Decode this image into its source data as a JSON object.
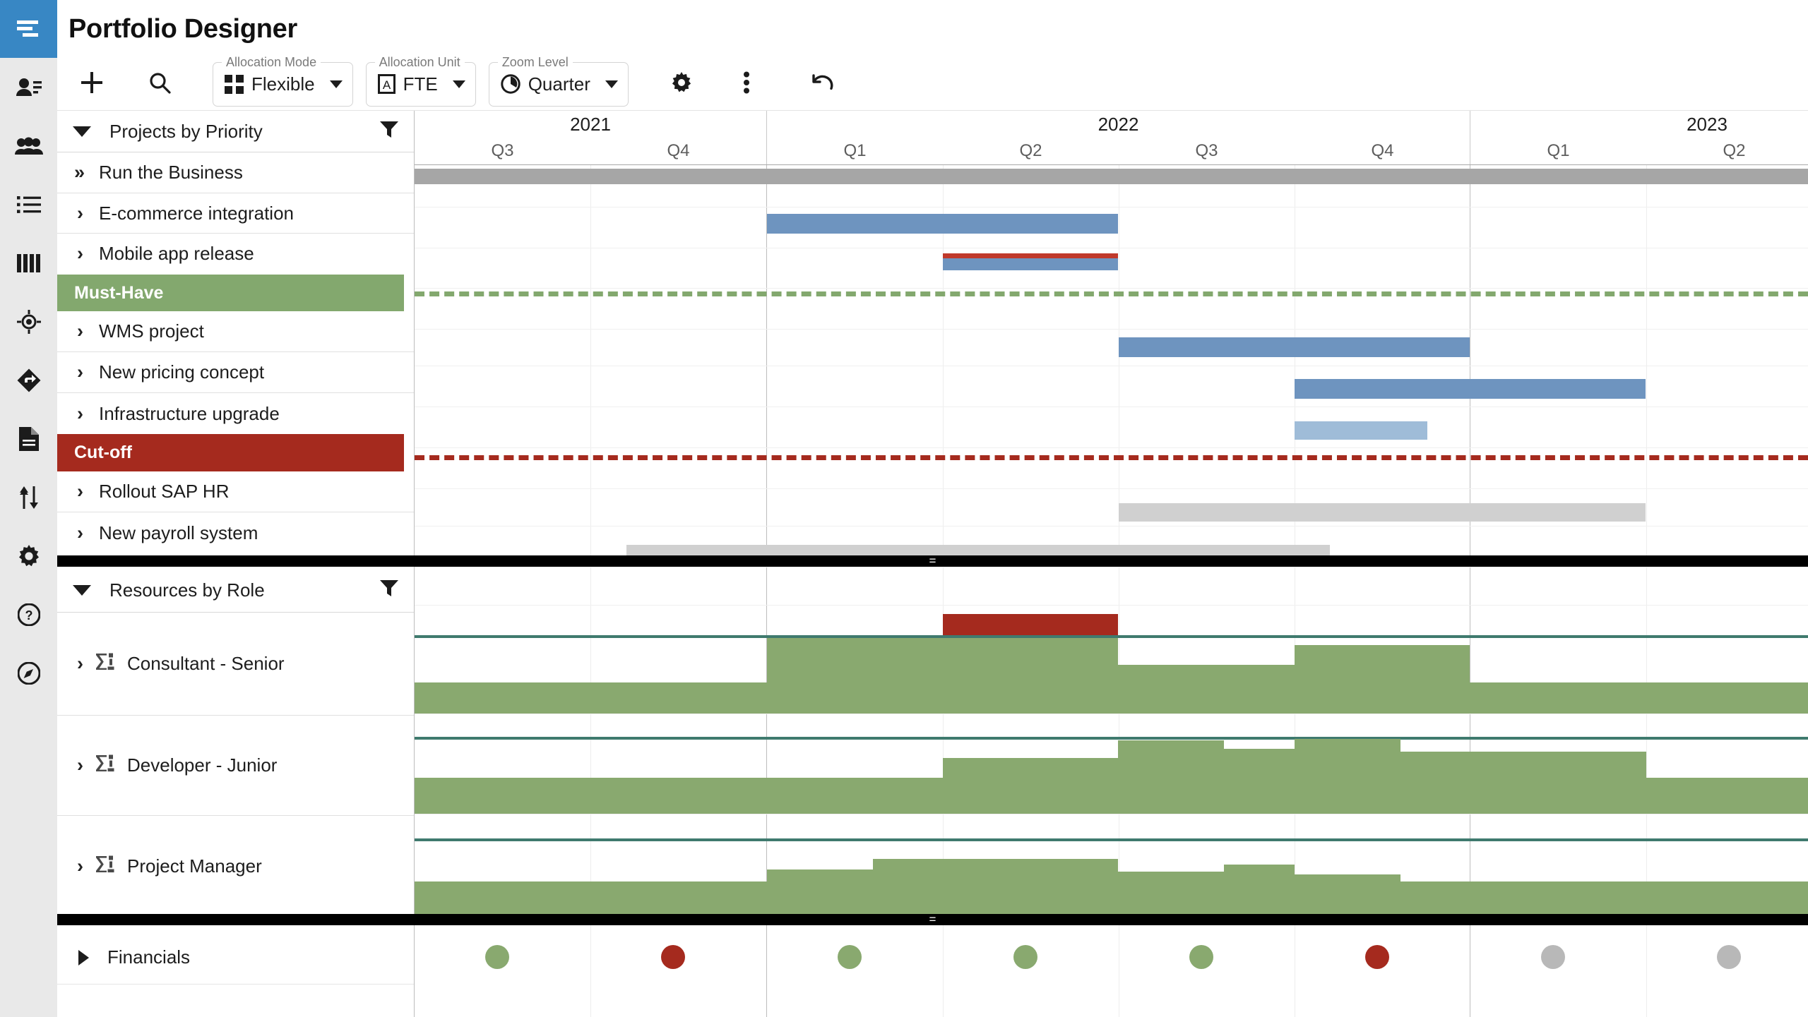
{
  "app": {
    "title": "Portfolio Designer",
    "accent_blue": "#3887c4",
    "rail_bg": "#e9e9e9"
  },
  "rail": {
    "items": [
      {
        "icon": "hamburger-menu-icon",
        "active": true
      },
      {
        "icon": "person-details-icon",
        "active": false
      },
      {
        "icon": "people-group-icon",
        "active": false
      },
      {
        "icon": "list-bullets-icon",
        "active": false
      },
      {
        "icon": "bar-columns-icon",
        "active": false
      },
      {
        "icon": "target-crosshair-icon",
        "active": false
      },
      {
        "icon": "route-directions-icon",
        "active": false
      },
      {
        "icon": "document-icon",
        "active": false
      },
      {
        "icon": "sort-arrows-icon",
        "active": false
      },
      {
        "icon": "gear-settings-icon",
        "active": false
      },
      {
        "icon": "help-question-icon",
        "active": false
      },
      {
        "icon": "compass-explore-icon",
        "active": false
      }
    ]
  },
  "toolbar": {
    "add_label": "+",
    "add_name": "add-icon",
    "search_name": "search-icon",
    "allocation_mode": {
      "legend": "Allocation Mode",
      "value": "Flexible",
      "icon": "grid-squares-icon"
    },
    "allocation_unit": {
      "legend": "Allocation Unit",
      "value": "FTE",
      "icon": "letter-a-boxed-icon"
    },
    "zoom_level": {
      "legend": "Zoom Level",
      "value": "Quarter",
      "icon": "clock-pie-icon"
    },
    "settings_name": "gear-icon",
    "more_name": "more-vertical-icon",
    "undo_name": "undo-arrow-icon"
  },
  "projects_panel": {
    "header": "Projects by Priority",
    "filter_icon": "filter-funnel-icon",
    "rows": [
      {
        "label": "Run the Business",
        "chevron": "double-chevron-right",
        "type": "project"
      },
      {
        "label": "E-commerce integration",
        "chevron": "chevron-right",
        "type": "project"
      },
      {
        "label": "Mobile app release",
        "chevron": "chevron-right",
        "type": "project"
      },
      {
        "label": "Must-Have",
        "type": "band",
        "color": "#83a86e",
        "text_color": "#ffffff"
      },
      {
        "label": "WMS project",
        "chevron": "chevron-right",
        "type": "project"
      },
      {
        "label": "New pricing concept",
        "chevron": "chevron-right",
        "type": "project"
      },
      {
        "label": "Infrastructure upgrade",
        "chevron": "chevron-right",
        "type": "project"
      },
      {
        "label": "Cut-off",
        "type": "band",
        "color": "#a52a1e",
        "text_color": "#ffffff"
      },
      {
        "label": "Rollout SAP HR",
        "chevron": "chevron-right",
        "type": "project"
      },
      {
        "label": "New payroll system",
        "chevron": "chevron-right",
        "type": "project"
      }
    ]
  },
  "resources_panel": {
    "header": "Resources by Role",
    "filter_icon": "filter-funnel-icon",
    "rows": [
      {
        "label": "Consultant - Senior",
        "chevron": "chevron-right",
        "icon": "sigma-resource-icon"
      },
      {
        "label": "Developer - Junior",
        "chevron": "chevron-right",
        "icon": "sigma-resource-icon"
      },
      {
        "label": "Project Manager",
        "chevron": "chevron-right",
        "icon": "sigma-resource-icon"
      }
    ]
  },
  "financials_panel": {
    "label": "Financials",
    "chevron": "chevron-right-collapsed"
  },
  "chart_data": {
    "type": "gantt",
    "title": "Portfolio Designer timeline",
    "timeline": {
      "unit": "Quarter",
      "years": [
        {
          "label": "2021",
          "start_index": 0,
          "span": 2
        },
        {
          "label": "2022",
          "start_index": 2,
          "span": 4
        },
        {
          "label": "2023",
          "start_index": 6,
          "span": 2
        }
      ],
      "quarters": [
        "Q3",
        "Q4",
        "Q1",
        "Q2",
        "Q3",
        "Q4",
        "Q1",
        "Q2"
      ],
      "major_boundaries": [
        2,
        6
      ]
    },
    "colors": {
      "bar_blue": "#6e94bf",
      "bar_blue_light": "#9fbcd8",
      "bar_grey": "#d0d0d0",
      "bar_grey_dark": "#a6a6a6",
      "bar_red": "#c0392b",
      "band_green": "#83a86e",
      "band_red": "#a52a1e",
      "histogram_green": "#89a96f",
      "histogram_over": "#a52a1e",
      "capacity_line": "#3f7a6e",
      "dot_green": "#89a96f",
      "dot_red": "#a52a1e",
      "dot_grey": "#b8b8b8"
    },
    "project_bars": [
      {
        "row": "Run the Business",
        "start_q": 0.0,
        "end_q": 8.0,
        "color": "bar_grey_dark",
        "height": 20,
        "full_width": true
      },
      {
        "row": "E-commerce integration",
        "start_q": 2.0,
        "end_q": 3.3,
        "color": "bar_blue",
        "height": 24
      },
      {
        "row": "Mobile app release",
        "start_q": 2.8,
        "end_q": 3.3,
        "color": "bar_blue",
        "height": 22,
        "top_stripe": "bar_red"
      },
      {
        "row": "WMS project",
        "start_q": 4.0,
        "end_q": 6.0,
        "color": "bar_blue",
        "height": 24
      },
      {
        "row": "New pricing concept",
        "start_q": 5.0,
        "end_q": 7.0,
        "color": "bar_blue",
        "height": 24
      },
      {
        "row": "Infrastructure upgrade",
        "start_q": 5.0,
        "end_q": 5.5,
        "color": "bar_blue_light",
        "height": 22
      },
      {
        "row": "Rollout SAP HR",
        "start_q": 4.0,
        "end_q": 7.0,
        "color": "bar_grey",
        "height": 24
      },
      {
        "row": "New payroll system",
        "start_q": 1.2,
        "end_q": 5.0,
        "color": "bar_grey",
        "height": 22
      }
    ],
    "baselines": [
      {
        "after_row": "Mobile app release",
        "label": "Must-Have",
        "color": "band_green",
        "style": "dashed"
      },
      {
        "after_row": "Infrastructure upgrade",
        "label": "Cut-off",
        "color": "band_red",
        "style": "dashed"
      }
    ],
    "resource_histograms": [
      {
        "role": "Consultant - Senior",
        "capacity": 100,
        "ylim": [
          0,
          130
        ],
        "over_allocation": [
          {
            "start_q": 2.8,
            "end_q": 3.3,
            "value": 118
          }
        ],
        "values": [
          {
            "start_q": 0.0,
            "end_q": 2.0,
            "value": 22
          },
          {
            "start_q": 2.0,
            "end_q": 3.3,
            "value": 86
          },
          {
            "start_q": 3.3,
            "end_q": 4.0,
            "value": 22
          },
          {
            "start_q": 4.0,
            "end_q": 5.0,
            "value": 56
          },
          {
            "start_q": 5.0,
            "end_q": 6.0,
            "value": 90
          },
          {
            "start_q": 6.0,
            "end_q": 8.0,
            "value": 22
          }
        ]
      },
      {
        "role": "Developer - Junior",
        "capacity": 100,
        "ylim": [
          0,
          130
        ],
        "over_allocation": [],
        "values": [
          {
            "start_q": 0.0,
            "end_q": 2.8,
            "value": 30
          },
          {
            "start_q": 2.8,
            "end_q": 4.0,
            "value": 58
          },
          {
            "start_q": 4.0,
            "end_q": 4.6,
            "value": 88
          },
          {
            "start_q": 4.6,
            "end_q": 5.0,
            "value": 72
          },
          {
            "start_q": 5.0,
            "end_q": 5.6,
            "value": 92
          },
          {
            "start_q": 5.6,
            "end_q": 7.0,
            "value": 64
          },
          {
            "start_q": 7.0,
            "end_q": 8.0,
            "value": 30
          }
        ]
      },
      {
        "role": "Project Manager",
        "capacity": 100,
        "ylim": [
          0,
          130
        ],
        "over_allocation": [],
        "values": [
          {
            "start_q": 0.0,
            "end_q": 2.0,
            "value": 18
          },
          {
            "start_q": 2.0,
            "end_q": 2.6,
            "value": 44
          },
          {
            "start_q": 2.6,
            "end_q": 4.0,
            "value": 62
          },
          {
            "start_q": 4.0,
            "end_q": 4.6,
            "value": 46
          },
          {
            "start_q": 4.6,
            "end_q": 5.0,
            "value": 58
          },
          {
            "start_q": 5.0,
            "end_q": 5.6,
            "value": 40
          },
          {
            "start_q": 5.6,
            "end_q": 6.0,
            "value": 30
          },
          {
            "start_q": 6.0,
            "end_q": 8.0,
            "value": 18
          }
        ]
      }
    ],
    "financial_indicators": [
      {
        "quarter": "Q3",
        "year": "2021",
        "status": "green"
      },
      {
        "quarter": "Q4",
        "year": "2021",
        "status": "red"
      },
      {
        "quarter": "Q1",
        "year": "2022",
        "status": "green"
      },
      {
        "quarter": "Q2",
        "year": "2022",
        "status": "green"
      },
      {
        "quarter": "Q3",
        "year": "2022",
        "status": "green"
      },
      {
        "quarter": "Q4",
        "year": "2022",
        "status": "red"
      },
      {
        "quarter": "Q1",
        "year": "2023",
        "status": "grey"
      },
      {
        "quarter": "Q2",
        "year": "2023",
        "status": "grey"
      }
    ]
  }
}
